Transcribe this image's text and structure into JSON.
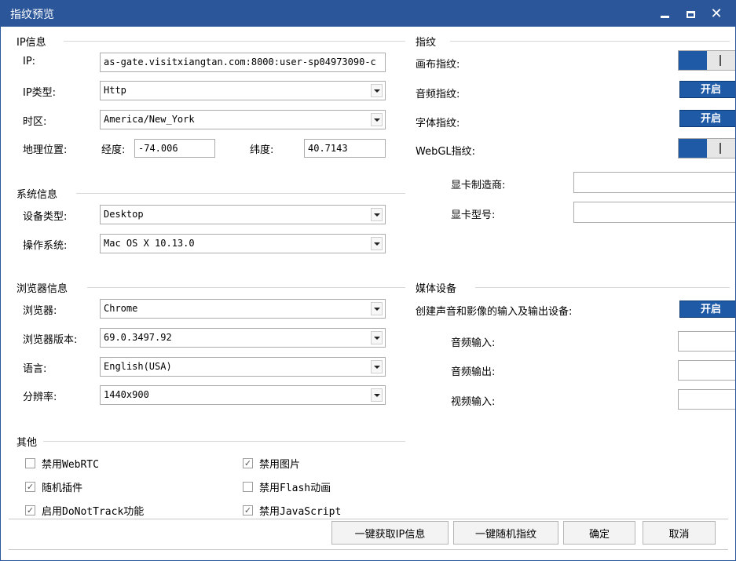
{
  "window": {
    "title": "指纹预览"
  },
  "ip_section": {
    "header": "IP信息",
    "ip_label": "IP:",
    "ip_value": "as-gate.visitxiangtan.com:8000:user-sp04973090-c",
    "type_label": "IP类型:",
    "type_value": "Http",
    "timezone_label": "时区:",
    "timezone_value": "America/New_York",
    "geo_label": "地理位置:",
    "lon_label": "经度:",
    "lon_value": "-74.006",
    "lat_label": "纬度:",
    "lat_value": "40.7143"
  },
  "system_section": {
    "header": "系统信息",
    "device_label": "设备类型:",
    "device_value": "Desktop",
    "os_label": "操作系统:",
    "os_value": "Mac OS X 10.13.0"
  },
  "browser_section": {
    "header": "浏览器信息",
    "browser_label": "浏览器:",
    "browser_value": "Chrome",
    "version_label": "浏览器版本:",
    "version_value": "69.0.3497.92",
    "lang_label": "语言:",
    "lang_value": "English(USA)",
    "res_label": "分辨率:",
    "res_value": "1440x900"
  },
  "other_section": {
    "header": "其他",
    "options": [
      {
        "label": "禁用WebRTC",
        "checked": false
      },
      {
        "label": "禁用图片",
        "checked": true
      },
      {
        "label": "随机插件",
        "checked": true
      },
      {
        "label": "禁用Flash动画",
        "checked": false
      },
      {
        "label": "启用DoNotTrack功能",
        "checked": true
      },
      {
        "label": "禁用JavaScript",
        "checked": true
      }
    ]
  },
  "fingerprint_section": {
    "header": "指纹",
    "canvas_label": "画布指纹:",
    "audio_label": "音频指纹:",
    "audio_toggle": "开启",
    "font_label": "字体指纹:",
    "font_toggle": "开启",
    "webgl_label": "WebGL指纹:",
    "gpu_vendor_label": "显卡制造商:",
    "gpu_model_label": "显卡型号:"
  },
  "media_section": {
    "header": "媒体设备",
    "create_label": "创建声音和影像的输入及输出设备:",
    "create_toggle": "开启",
    "audio_in_label": "音频输入:",
    "audio_out_label": "音频输出:",
    "video_in_label": "视频输入:"
  },
  "footer": {
    "get_ip": "一键获取IP信息",
    "random": "一键随机指纹",
    "ok": "确定",
    "cancel": "取消"
  }
}
